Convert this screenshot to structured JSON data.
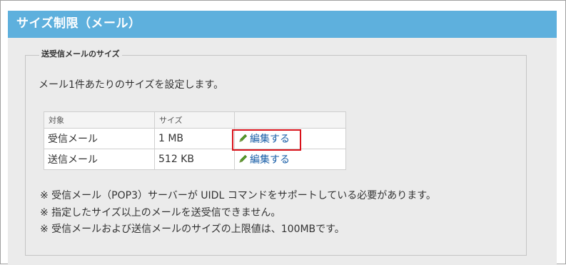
{
  "section": {
    "title": "サイズ制限（メール）",
    "legend": "送受信メールのサイズ",
    "description": "メール1件あたりのサイズを設定します。"
  },
  "table": {
    "headers": [
      "対象",
      "サイズ",
      ""
    ],
    "rows": [
      {
        "target": "受信メール",
        "size": "1 MB",
        "action": "編集する",
        "highlighted": true
      },
      {
        "target": "送信メール",
        "size": "512 KB",
        "action": "編集する",
        "highlighted": false
      }
    ]
  },
  "notes": [
    "※ 受信メール（POP3）サーバーが UIDL コマンドをサポートしている必要があります。",
    "※ 指定したサイズ以上のメールを送受信できません。",
    "※ 受信メールおよび送信メールのサイズの上限値は、100MBです。"
  ],
  "icons": {
    "edit": "pencil-icon"
  },
  "colors": {
    "header_bg": "#5eb0dd",
    "panel_bg": "#ebebeb",
    "link": "#1a5fa8",
    "highlight": "#d9121b",
    "pencil": "#5a9e2a"
  }
}
